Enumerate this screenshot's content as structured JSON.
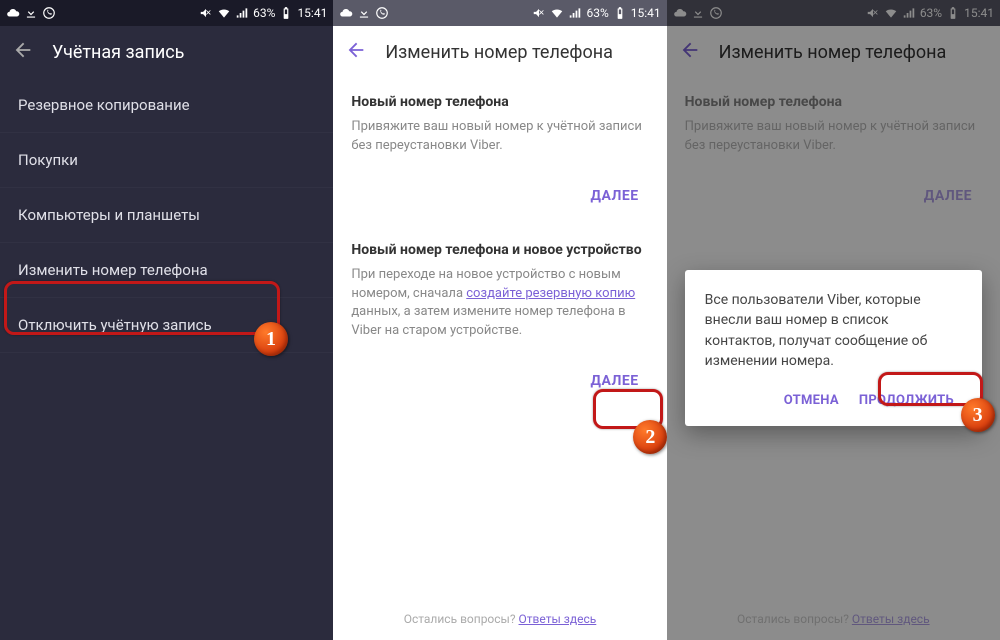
{
  "status": {
    "battery": "63%",
    "time": "15:41"
  },
  "screen1": {
    "title": "Учётная запись",
    "items": [
      "Резервное копирование",
      "Покупки",
      "Компьютеры и планшеты",
      "Изменить номер телефона",
      "Отключить учётную запись"
    ]
  },
  "screen2": {
    "title": "Изменить номер телефона",
    "sec1_title": "Новый номер телефона",
    "sec1_desc": "Привяжите ваш новый номер к учётной записи без переустановки Viber.",
    "next": "ДАЛЕЕ",
    "sec2_title": "Новый номер телефона и новое устройство",
    "sec2_desc_a": "При переходе на новое устройство с новым номером, сначала ",
    "sec2_link": "создайте резервную копию",
    "sec2_desc_b": " данных, а затем измените номер телефона в Viber на старом устройстве.",
    "footer_q": "Остались вопросы? ",
    "footer_link": "Ответы здесь"
  },
  "screen3": {
    "dialog_text": "Все пользователи Viber, которые внесли ваш номер в список контактов, получат сообщение об изменении номера.",
    "cancel": "ОТМЕНА",
    "continue": "ПРОДОЛЖИТЬ"
  },
  "badges": {
    "b1": "1",
    "b2": "2",
    "b3": "3"
  }
}
